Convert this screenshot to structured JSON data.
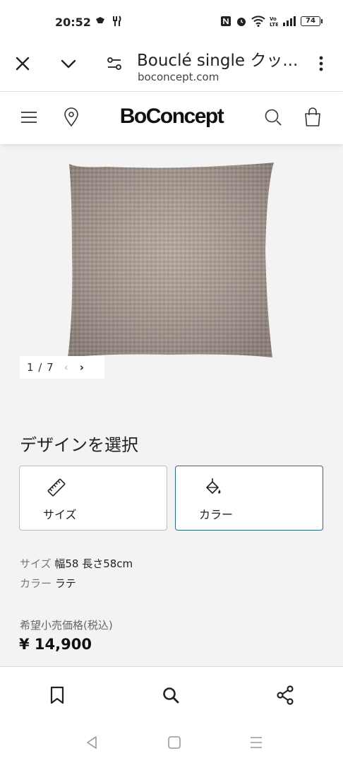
{
  "status_bar": {
    "time": "20:52",
    "battery": "74",
    "icons": [
      "ginkgo-icon",
      "fork-knife-icon",
      "nfc-icon",
      "alarm-icon",
      "wifi-icon",
      "volte-icon",
      "signal-icon",
      "battery-icon"
    ]
  },
  "browser": {
    "title": "Bouclé single クッ...",
    "url": "boconcept.com",
    "icons": [
      "close-icon",
      "chevron-down-icon",
      "tune-icon",
      "more-vert-icon"
    ]
  },
  "site_header": {
    "logo": "BoConcept",
    "icons": [
      "hamburger-menu-icon",
      "location-pin-icon",
      "search-icon",
      "shopping-bag-icon"
    ]
  },
  "gallery": {
    "pager_text": "1 / 7",
    "prev_symbol": "‹",
    "next_symbol": "›",
    "pillow_color": "#a99a92"
  },
  "design": {
    "title": "デザインを選択",
    "options": [
      {
        "label": "サイズ",
        "icon": "ruler-icon",
        "selected": false
      },
      {
        "label": "カラー",
        "icon": "paint-bucket-icon",
        "selected": true
      }
    ],
    "accent_color": "#2a6c7c"
  },
  "specs": {
    "size_label": "サイズ",
    "size_value": "幅58 長さ58cm",
    "color_label": "カラー",
    "color_value": "ラテ"
  },
  "price": {
    "label": "希望小売価格(税込)",
    "value": "¥ 14,900"
  },
  "bottom_bar": {
    "icons": [
      "bookmark-icon",
      "search-icon",
      "share-icon"
    ]
  },
  "nav_bar": {
    "icons": [
      "back-icon",
      "home-icon",
      "recents-icon"
    ]
  }
}
